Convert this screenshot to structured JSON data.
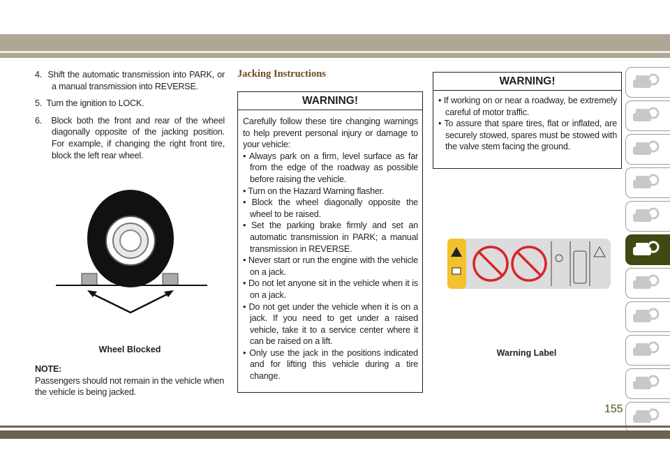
{
  "left": {
    "steps": [
      {
        "num": "4.",
        "text": "Shift the automatic transmission into PARK, or a manual transmission into REVERSE."
      },
      {
        "num": "5.",
        "text": "Turn the ignition to LOCK."
      },
      {
        "num": "6.",
        "text": "Block both the front and rear of the wheel diagonally opposite of the jacking position. For example, if changing the right front tire, block the left rear wheel."
      }
    ],
    "figure_caption": "Wheel Blocked",
    "note_title": "NOTE:",
    "note_text": "Passengers should not remain in the vehicle when the vehicle is being jacked."
  },
  "middle": {
    "section_title": "Jacking Instructions",
    "warning_title": "WARNING!",
    "intro": "Carefully follow these tire changing warnings to help prevent personal injury or damage to your vehicle:",
    "bullets": [
      "Always park on a firm, level surface as far from the edge of the roadway as possible before raising the vehicle.",
      "Turn on the Hazard Warning flasher.",
      "Block the wheel diagonally opposite the wheel to be raised.",
      "Set the parking brake firmly and set an automatic transmission in PARK; a manual transmission in REVERSE.",
      "Never start or run the engine with the vehicle on a jack.",
      "Do not let anyone sit in the vehicle when it is on a jack.",
      "Do not get under the vehicle when it is on a jack. If you need to get under a raised vehicle, take it to a service center where it can be raised on a lift.",
      "Only use the jack in the positions indicated and for lifting this vehicle during a tire change."
    ]
  },
  "right": {
    "warning_title": "WARNING!",
    "bullets": [
      "If working on or near a roadway, be extremely careful of motor traffic.",
      "To assure that spare tires, flat or inflated, are securely stowed, spares must be stowed with the valve stem facing the ground."
    ],
    "figure_caption": "Warning Label"
  },
  "side_tabs": [
    {
      "icon": "car-search-icon"
    },
    {
      "icon": "car-info-icon"
    },
    {
      "icon": "light-message-icon"
    },
    {
      "icon": "airbag-seat-icon"
    },
    {
      "icon": "key-steering-wheel-icon"
    },
    {
      "icon": "car-warning-triangle-icon",
      "active": true
    },
    {
      "icon": "car-wrench-icon"
    },
    {
      "icon": "specs-gear-icon"
    },
    {
      "icon": "multimedia-icon"
    },
    {
      "icon": "search-icon"
    },
    {
      "icon": "index-search-icon"
    }
  ],
  "page_number": "155",
  "colors": {
    "band_top": "#aea795",
    "band_bottom": "#6b6252",
    "active_tab": "#3f4a12",
    "section_title": "#6b4b1e",
    "label_yellow": "#f2c12e"
  }
}
